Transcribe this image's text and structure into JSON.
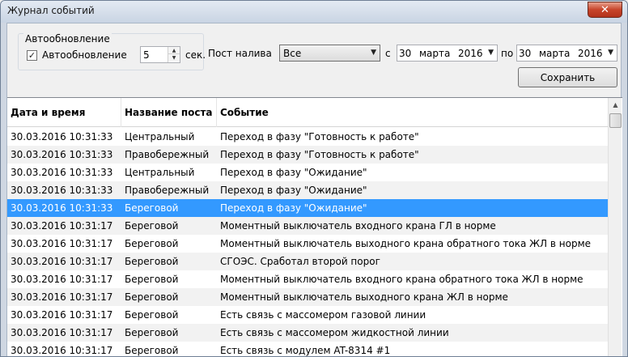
{
  "window": {
    "title": "Журнал событий",
    "close_glyph": "✕"
  },
  "autoupdate": {
    "group_label": "Автообновление",
    "checkbox_label": "Автообновление",
    "checked": true,
    "check_glyph": "✓",
    "interval_value": "5",
    "interval_unit": "сек.",
    "spin_up_glyph": "▲",
    "spin_down_glyph": "▼"
  },
  "filter": {
    "post_label": "Пост налива",
    "post_value": "Все",
    "dropdown_glyph": "▼",
    "from_label": "с",
    "to_label": "по",
    "from_date": {
      "day": "30",
      "month": "марта",
      "year": "2016"
    },
    "to_date": {
      "day": "30",
      "month": "марта",
      "year": "2016"
    }
  },
  "toolbar": {
    "save_label": "Сохранить"
  },
  "table": {
    "columns": [
      "Дата и время",
      "Название поста",
      "Событие"
    ],
    "selected_index": 4,
    "rows": [
      {
        "datetime": "30.03.2016 10:31:33",
        "post": "Центральный",
        "event": "Переход в фазу \"Готовность к работе\""
      },
      {
        "datetime": "30.03.2016 10:31:33",
        "post": "Правобережный",
        "event": "Переход в фазу \"Готовность к работе\""
      },
      {
        "datetime": "30.03.2016 10:31:33",
        "post": "Центральный",
        "event": "Переход в фазу \"Ожидание\""
      },
      {
        "datetime": "30.03.2016 10:31:33",
        "post": "Правобережный",
        "event": "Переход в фазу \"Ожидание\""
      },
      {
        "datetime": "30.03.2016 10:31:33",
        "post": "Береговой",
        "event": "Переход в фазу \"Ожидание\""
      },
      {
        "datetime": "30.03.2016 10:31:17",
        "post": "Береговой",
        "event": "Моментный выключатель входного крана ГЛ в норме"
      },
      {
        "datetime": "30.03.2016 10:31:17",
        "post": "Береговой",
        "event": "Моментный выключатель выходного крана обратного тока ЖЛ в норме"
      },
      {
        "datetime": "30.03.2016 10:31:17",
        "post": "Береговой",
        "event": "СГОЭС. Сработал второй порог"
      },
      {
        "datetime": "30.03.2016 10:31:17",
        "post": "Береговой",
        "event": "Моментный выключатель входного крана обратного тока ЖЛ в норме"
      },
      {
        "datetime": "30.03.2016 10:31:17",
        "post": "Береговой",
        "event": "Моментный выключатель выходного крана ЖЛ в норме"
      },
      {
        "datetime": "30.03.2016 10:31:17",
        "post": "Береговой",
        "event": "Есть связь с массомером газовой линии"
      },
      {
        "datetime": "30.03.2016 10:31:17",
        "post": "Береговой",
        "event": "Есть связь с массомером жидкостной линии"
      },
      {
        "datetime": "30.03.2016 10:31:17",
        "post": "Береговой",
        "event": "Есть связь с модулем AT-8314 #1"
      }
    ]
  },
  "scrollbar": {
    "up_glyph": "▲"
  }
}
